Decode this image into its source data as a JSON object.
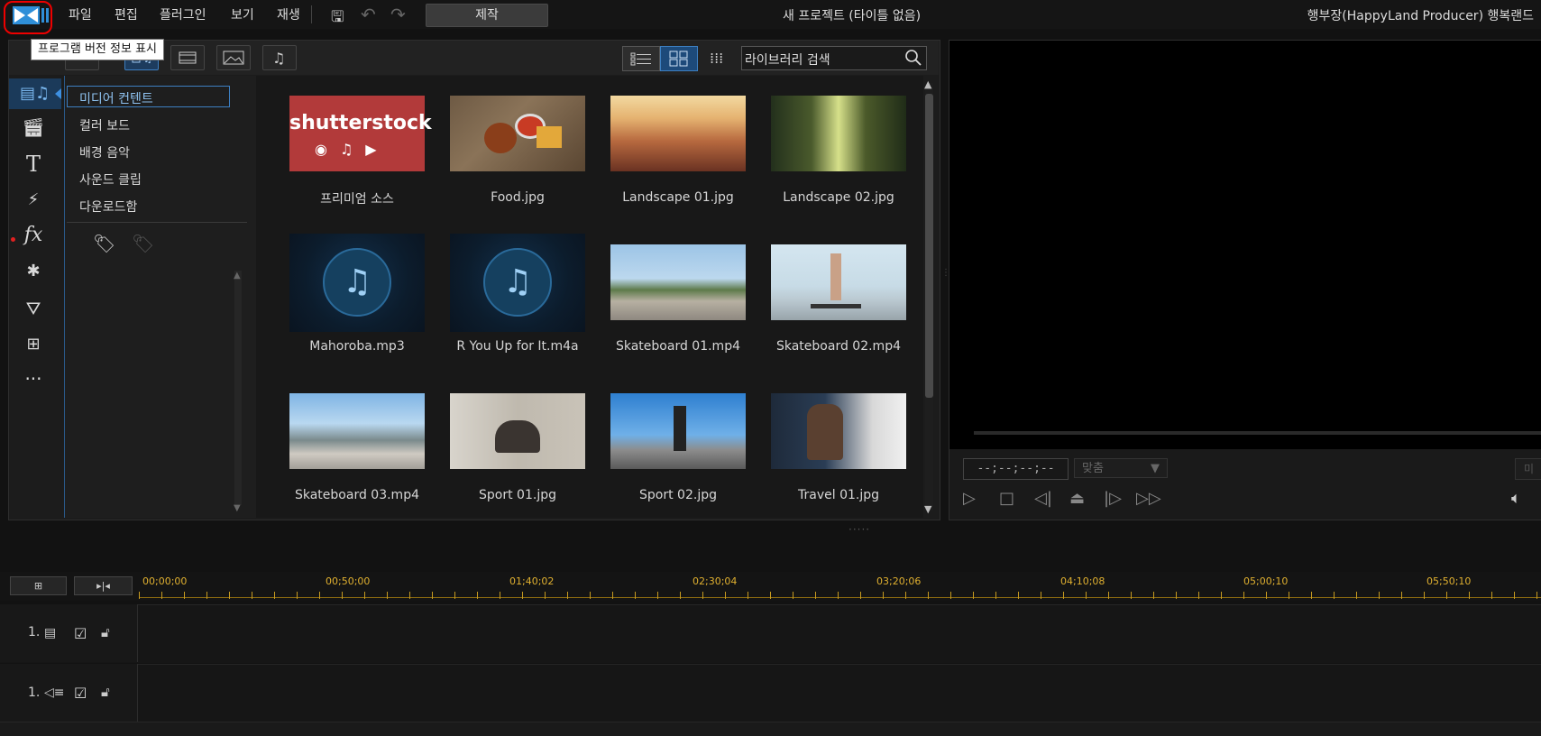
{
  "app": {
    "logo_icon": "powerdirector-logo-icon",
    "tooltip": "프로그램 버전 정보 표시"
  },
  "menu": {
    "items": [
      "파일",
      "편집",
      "플러그인",
      "보기",
      "재생"
    ],
    "produce_label": "제작",
    "project_title": "새 프로젝트 (타이틀 없음)",
    "user": "행부장(HappyLand Producer) 행복랜드"
  },
  "library": {
    "search_placeholder": "라이브러리 검색",
    "categories": [
      "미디어 컨텐트",
      "컬러 보드",
      "배경 음악",
      "사운드 클립",
      "다운로드함"
    ],
    "selected_category": "미디어 컨텐트",
    "items": [
      {
        "caption": "프리미엄 소스",
        "type": "shutterstock",
        "brand": "shutterstock"
      },
      {
        "caption": "Food.jpg",
        "type": "image"
      },
      {
        "caption": "Landscape 01.jpg",
        "type": "image"
      },
      {
        "caption": "Landscape 02.jpg",
        "type": "image"
      },
      {
        "caption": "Mahoroba.mp3",
        "type": "audio"
      },
      {
        "caption": "R You Up for It.m4a",
        "type": "audio"
      },
      {
        "caption": "Skateboard 01.mp4",
        "type": "video"
      },
      {
        "caption": "Skateboard 02.mp4",
        "type": "video"
      },
      {
        "caption": "Skateboard 03.mp4",
        "type": "video"
      },
      {
        "caption": "Sport 01.jpg",
        "type": "image"
      },
      {
        "caption": "Sport 02.jpg",
        "type": "image"
      },
      {
        "caption": "Travel 01.jpg",
        "type": "image"
      }
    ]
  },
  "preview": {
    "timecode": "--;--;--;--",
    "fit_label": "맞춤",
    "corner_label": "미"
  },
  "timeline": {
    "ticks": [
      "00;00;00",
      "00;50;00",
      "01;40;02",
      "02;30;04",
      "03;20;06",
      "04;10;08",
      "05;00;10",
      "05;50;10"
    ],
    "tracks": [
      {
        "label": "1.",
        "kind": "video"
      },
      {
        "label": "1.",
        "kind": "audio"
      }
    ]
  },
  "colors": {
    "accent": "#3d7fc1",
    "ruler": "#e0b030",
    "highlight_ring": "#e00000",
    "shutterstock_red": "#b23a3a"
  }
}
